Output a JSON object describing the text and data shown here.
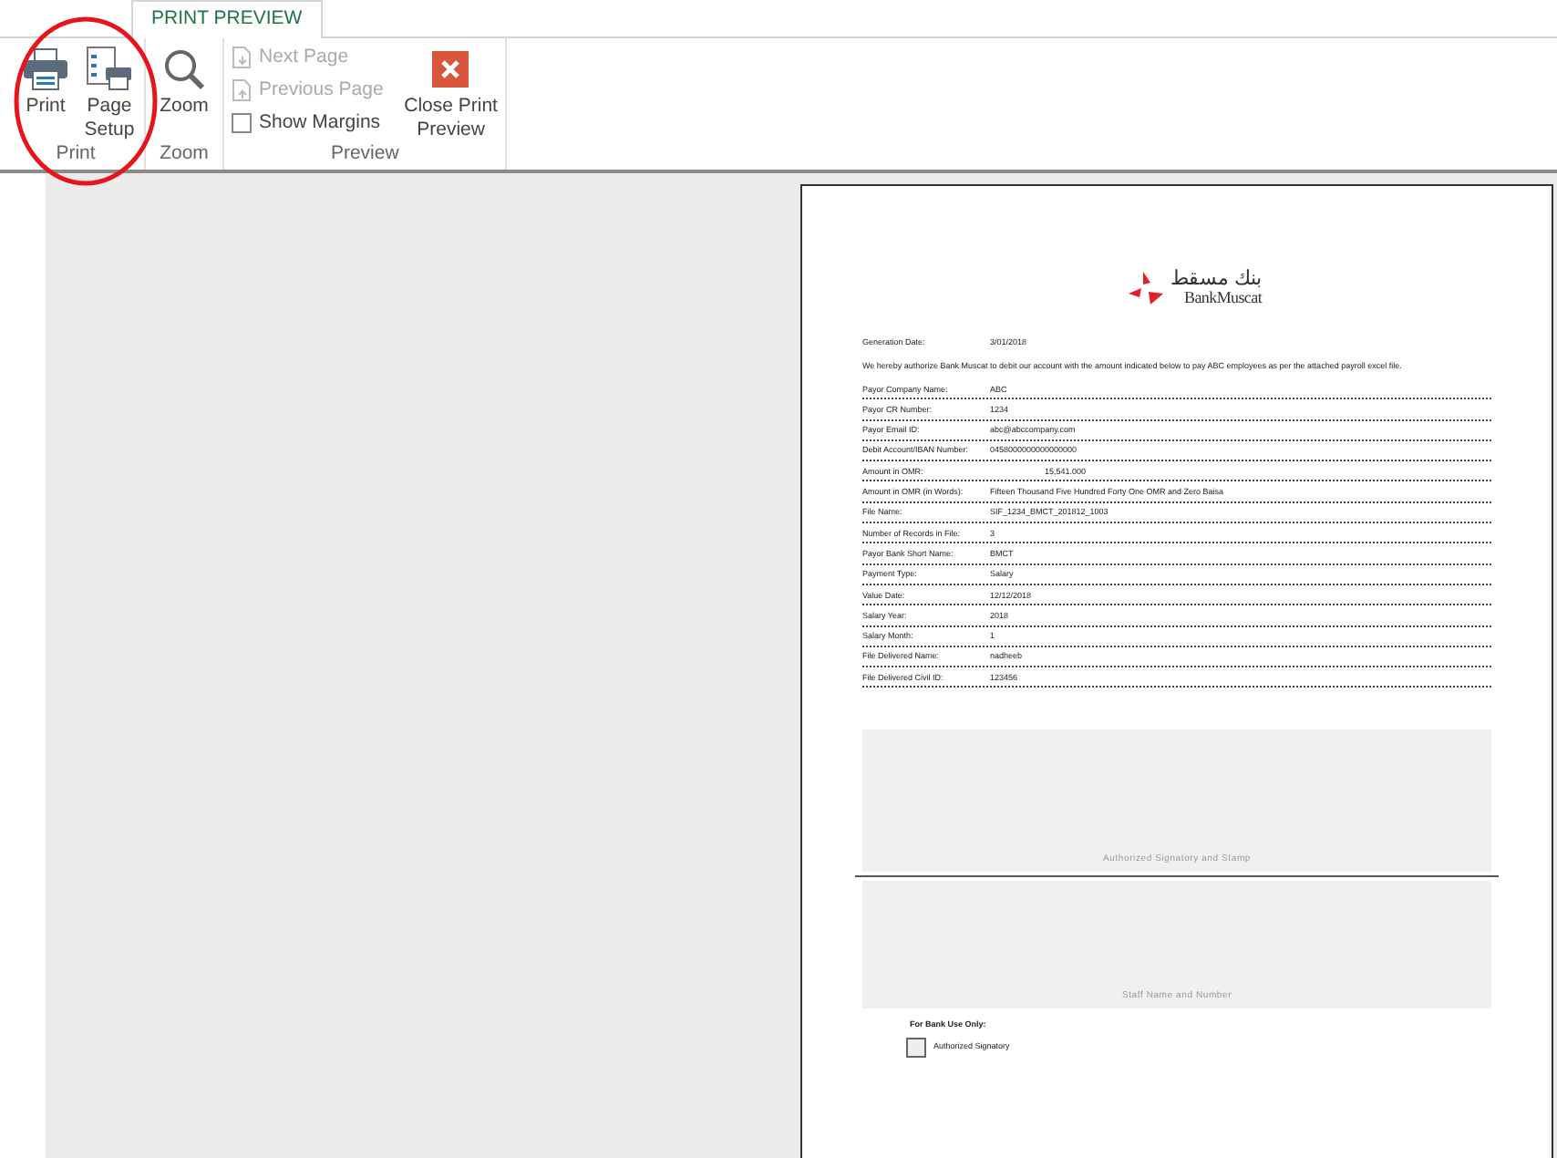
{
  "ribbon": {
    "tabs": [
      {
        "label": "PRINT PREVIEW",
        "selected": true
      }
    ],
    "groups": [
      {
        "label": "Print",
        "items": [
          {
            "kind": "large",
            "label": "Print"
          },
          {
            "kind": "large",
            "label": "Page Setup"
          }
        ]
      },
      {
        "label": "Zoom",
        "items": [
          {
            "kind": "large",
            "label": "Zoom"
          }
        ]
      },
      {
        "label": "Preview",
        "items": [
          {
            "kind": "small",
            "label": "Next Page",
            "disabled": true
          },
          {
            "kind": "small",
            "label": "Previous Page",
            "disabled": true
          },
          {
            "kind": "checkbox",
            "label": "Show Margins",
            "checked": false
          },
          {
            "kind": "large",
            "label": "Close Print Preview"
          }
        ]
      }
    ]
  },
  "document": {
    "logo": {
      "arabic": "بنك مسقط",
      "latin": "BankMuscat"
    },
    "generation_date": {
      "label": "Generation Date:",
      "value": "3/01/2018"
    },
    "intro": "We hereby authorize Bank Muscat to debit our account with the amount indicated below to pay ABC employees as per the attached payroll excel file.",
    "fields": [
      {
        "label": "Payor Company Name:",
        "value": "ABC"
      },
      {
        "label": "Payor CR Number:",
        "value": "1234"
      },
      {
        "label": "Payor Email ID:",
        "value": "abc@abccompany.com"
      },
      {
        "label": "Debit Account/IBAN Number:",
        "value": "0458000000000000000"
      },
      {
        "label": "Amount in OMR:",
        "value": "15,541.000",
        "kind": "amount"
      },
      {
        "label": "Amount in OMR (in Words):",
        "value": "Fifteen Thousand Five Hundred Forty One OMR and Zero Baisa"
      },
      {
        "label": "File Name:",
        "value": "SIF_1234_BMCT_201812_1003"
      },
      {
        "label": "Number of Records in File:",
        "value": "3"
      },
      {
        "label": "Payor Bank Short Name:",
        "value": "BMCT"
      },
      {
        "label": "Payment Type:",
        "value": "Salary"
      },
      {
        "label": "Value Date:",
        "value": "12/12/2018"
      },
      {
        "label": "Salary Year:",
        "value": "2018"
      },
      {
        "label": "Salary Month:",
        "value": "1"
      },
      {
        "label": "File Delivered Name:",
        "value": "nadheeb"
      },
      {
        "label": "File Delivered Civil ID:",
        "value": "123456"
      }
    ],
    "signature_boxes": [
      {
        "caption": "Authorized Signatory and Stamp"
      },
      {
        "caption": "Staff Name and Number"
      }
    ],
    "bank_use": {
      "title": "For Bank Use Only:",
      "checkbox": {
        "label": "Authorized Signatory",
        "checked": false
      }
    }
  }
}
